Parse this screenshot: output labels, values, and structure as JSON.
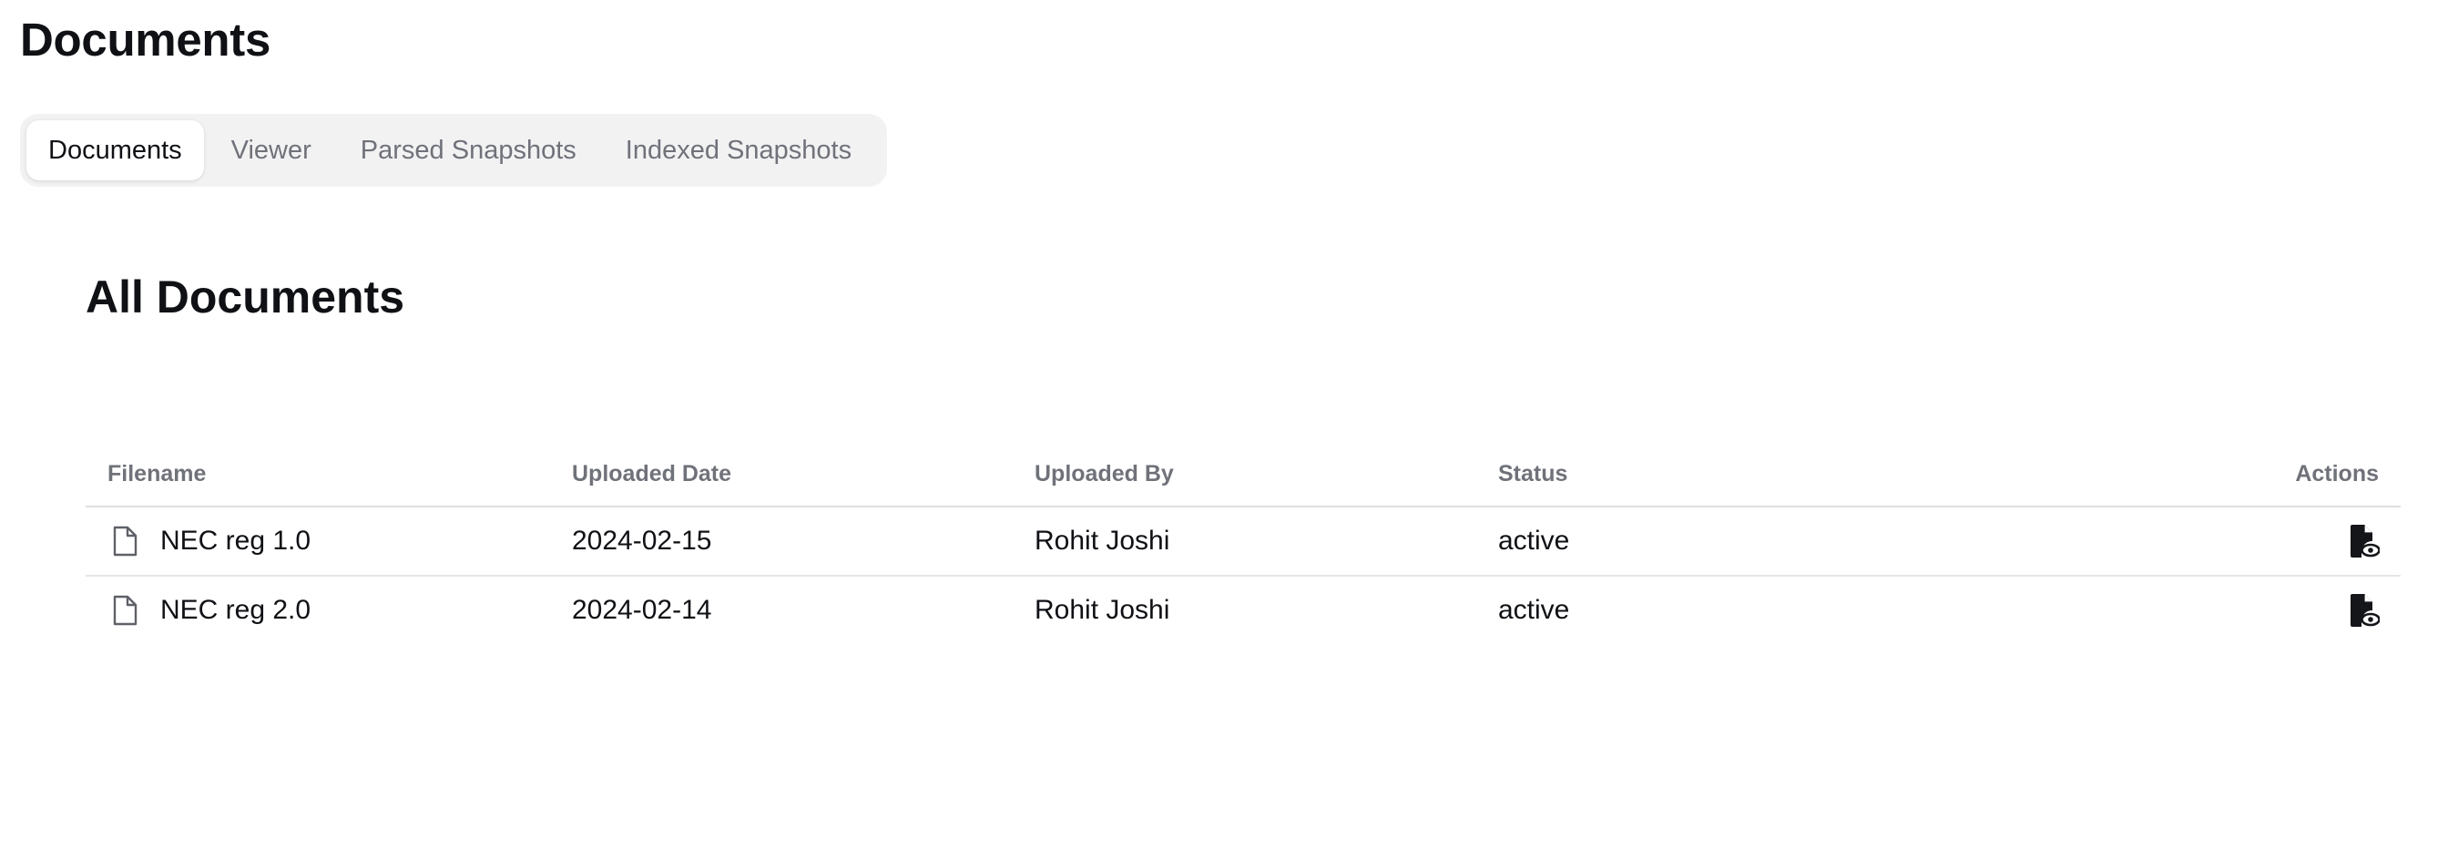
{
  "page": {
    "title": "Documents"
  },
  "tabs": [
    {
      "label": "Documents",
      "active": true
    },
    {
      "label": "Viewer",
      "active": false
    },
    {
      "label": "Parsed Snapshots",
      "active": false
    },
    {
      "label": "Indexed Snapshots",
      "active": false
    }
  ],
  "section": {
    "title": "All Documents"
  },
  "table": {
    "headers": {
      "filename": "Filename",
      "uploaded_date": "Uploaded Date",
      "uploaded_by": "Uploaded By",
      "status": "Status",
      "actions": "Actions"
    },
    "rows": [
      {
        "filename": "NEC reg 1.0",
        "uploaded_date": "2024-02-15",
        "uploaded_by": "Rohit Joshi",
        "status": "active",
        "file_icon": "file-outline-icon",
        "action_icon": "file-view-icon"
      },
      {
        "filename": "NEC reg 2.0",
        "uploaded_date": "2024-02-14",
        "uploaded_by": "Rohit Joshi",
        "status": "active",
        "file_icon": "file-outline-icon",
        "action_icon": "file-view-icon"
      }
    ]
  }
}
